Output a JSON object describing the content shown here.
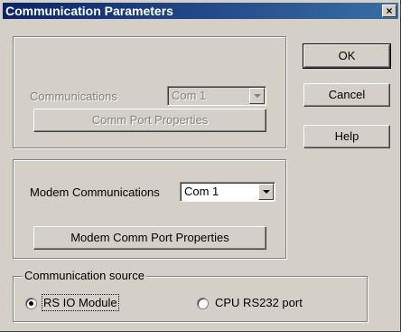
{
  "window": {
    "title": "Communication Parameters",
    "close_glyph": "×"
  },
  "disabled_group": {
    "label": "Communications",
    "combo_value": "Com 1",
    "button_label": "Comm Port Properties"
  },
  "modem_group": {
    "label": "Modem Communications",
    "combo_value": "Com 1",
    "button_label": "Modem Comm Port Properties"
  },
  "source_group": {
    "legend": "Communication source",
    "options": [
      {
        "label": "RS IO Module",
        "checked": true
      },
      {
        "label": "CPU RS232 port",
        "checked": false
      }
    ]
  },
  "buttons": {
    "ok": "OK",
    "cancel": "Cancel",
    "help": "Help"
  }
}
